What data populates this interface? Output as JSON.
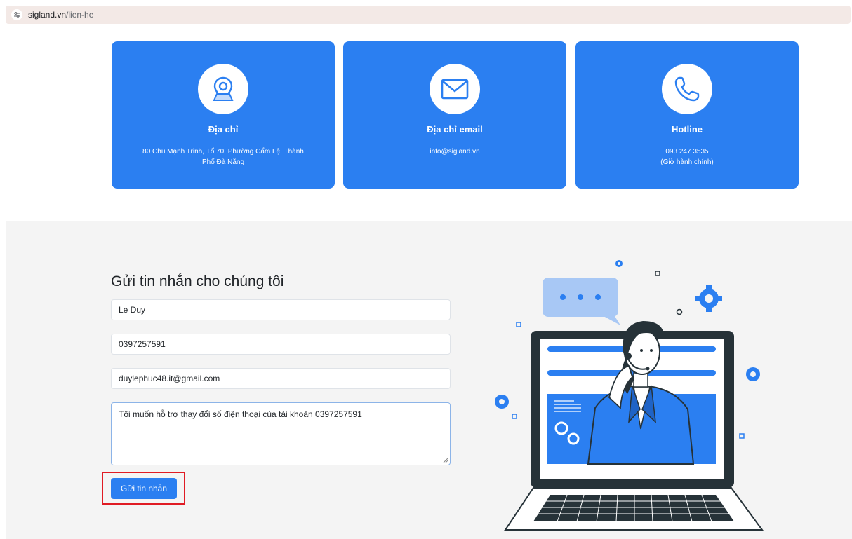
{
  "browser": {
    "url_host": "sigland.vn",
    "url_path": "/lien-he"
  },
  "contact_cards": [
    {
      "icon": "location-pin-icon",
      "title": "Địa chỉ",
      "lines": [
        "80 Chu Mạnh Trinh, Tổ 70, Phường Cẩm Lệ, Thành",
        "Phố Đà Nẵng"
      ]
    },
    {
      "icon": "envelope-icon",
      "title": "Địa chỉ email",
      "lines": [
        "info@sigland.vn"
      ]
    },
    {
      "icon": "phone-icon",
      "title": "Hotline",
      "lines": [
        "093 247 3535",
        "(Giờ hành chính)"
      ]
    }
  ],
  "form": {
    "title": "Gửi tin nhắn cho chúng tôi",
    "name_value": "Le Duy",
    "phone_value": "0397257591",
    "email_value": "duylephuc48.it@gmail.com",
    "message_value": "Tôi muốn hỗ trợ thay đổi số điện thoại của tài khoản 0397257591",
    "submit_label": "Gửi tin nhắn"
  },
  "colors": {
    "primary": "#2b7ff1",
    "section_bg": "#f4f4f4",
    "highlight": "#e01b24",
    "dark": "#263238"
  }
}
